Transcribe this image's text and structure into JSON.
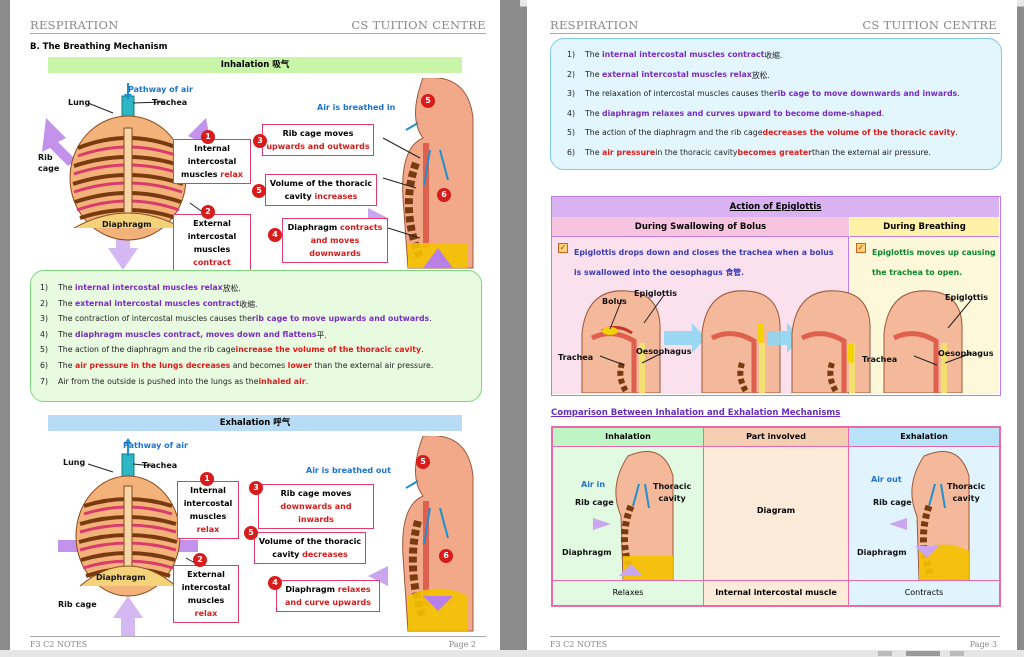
{
  "header": {
    "left": "RESPIRATION",
    "right": "CS TUITION CENTRE"
  },
  "page2": {
    "section_title": "B. The Breathing Mechanism",
    "inhalation_bar": "Inhalation 吸气",
    "exhalation_bar": "Exhalation 呼气",
    "footer_left": "F3 C2 NOTES",
    "footer_right": "Page 2",
    "inh": {
      "pathway": "Pathway of air",
      "lung": "Lung",
      "trachea": "Trachea",
      "rib_cage": "Rib cage",
      "diaphragm": "Diaphragm",
      "air_in": "Air is breathed in",
      "box1": [
        "Internal",
        "intercostal",
        "muscles",
        "relax"
      ],
      "box2": [
        "External",
        "intercostal",
        "muscles",
        "contract"
      ],
      "box3": [
        "Rib cage moves",
        "upwards and outwards"
      ],
      "box4": [
        "Diaphragm",
        "contracts",
        "and moves downwards"
      ],
      "box5": [
        "Volume of the thoracic",
        "cavity",
        "increases"
      ],
      "n1": "1",
      "n2": "2",
      "n3": "3",
      "n4": "4",
      "n5": "5",
      "n6": "6"
    },
    "inh_list": [
      [
        "1)",
        "The ",
        "internal intercostal muscles relax",
        " 放松."
      ],
      [
        "2)",
        "The ",
        "external intercostal muscles contract",
        " 收缩."
      ],
      [
        "3)",
        "The contraction of intercostal muscles causes the ",
        "rib cage to move upwards and outwards",
        "."
      ],
      [
        "4)",
        "The ",
        "diaphragm muscles contract, moves down and flattens",
        " 平."
      ],
      [
        "5)",
        "The action of the diaphragm and the rib cage ",
        "increase the volume of the thoracic cavity",
        "."
      ],
      [
        "6)",
        "The ",
        "air pressure in the lungs decreases",
        " and becomes ",
        "lower",
        " than the external air pressure."
      ],
      [
        "7)",
        "Air from the outside is pushed into the lungs as the ",
        "inhaled air",
        "."
      ]
    ],
    "exh": {
      "pathway": "Pathway of air",
      "lung": "Lung",
      "trachea": "Trachea",
      "rib_cage": "Rib cage",
      "diaphragm": "Diaphragm",
      "air_out": "Air is breathed out",
      "box1": [
        "Internal",
        "intercostal",
        "muscles",
        "relax"
      ],
      "box2": [
        "External",
        "intercostal",
        "muscles",
        "relax"
      ],
      "box3": [
        "Rib cage moves",
        "downwards and inwards"
      ],
      "box4": [
        "Diaphragm",
        "relaxes",
        "and curve upwards"
      ],
      "box5": [
        "Volume of the thoracic",
        "cavity",
        "decreases"
      ],
      "n1": "1",
      "n2": "2",
      "n3": "3",
      "n4": "4",
      "n5": "5",
      "n6": "6"
    }
  },
  "page3": {
    "footer_left": "F3 C2 NOTES",
    "footer_right": "Page 3",
    "exh_list": [
      [
        "1)",
        "The ",
        "internal intercostal muscles contract",
        " 收缩."
      ],
      [
        "2)",
        "The ",
        "external intercostal muscles relax",
        " 放松."
      ],
      [
        "3)",
        "The relaxation of intercostal muscles causes the ",
        "rib cage to move downwards and inwards",
        "."
      ],
      [
        "4)",
        "The ",
        "diaphragm relaxes and curves upward to become dome-shaped",
        "."
      ],
      [
        "5)",
        "The action of the diaphragm and the rib cage ",
        "decreases the volume of the thoracic cavity",
        "."
      ],
      [
        "6)",
        "The ",
        "air pressure",
        " in the thoracic cavity ",
        "becomes greater",
        " than the external air pressure."
      ]
    ],
    "epiglottis": {
      "title": "Action of Epiglottis",
      "col1": "During Swallowing of Bolus",
      "col2": "During Breathing",
      "text1": [
        "Epiglottis drops down and closes the trachea when a bolus",
        "is swallowed into the oesophagus 食管."
      ],
      "text2": [
        "Epiglottis moves up causing",
        "the trachea to open."
      ],
      "bolus": "Bolus",
      "epiglottis": "Epiglottis",
      "trachea": "Trachea",
      "oesophagus": "Oesophagus"
    },
    "comparison": {
      "title": "Comparison Between Inhalation and Exhalation Mechanisms",
      "headers": [
        "Inhalation",
        "Part involved",
        "Exhalation"
      ],
      "air_in": "Air in",
      "air_out": "Air out",
      "rib_cage": "Rib cage",
      "thoracic": [
        "Thoracic",
        "cavity"
      ],
      "diaphragm": "Diaphragm",
      "diagram": "Diagram",
      "row2": [
        "Relaxes",
        "Internal intercostal muscle",
        "Contracts"
      ]
    }
  },
  "colors": {
    "pink": "#e23b6a",
    "red": "#d81b1b",
    "green_bar": "#c8f5a8",
    "blue_bar": "#b8dcf5",
    "purple": "#7a2cc4"
  }
}
